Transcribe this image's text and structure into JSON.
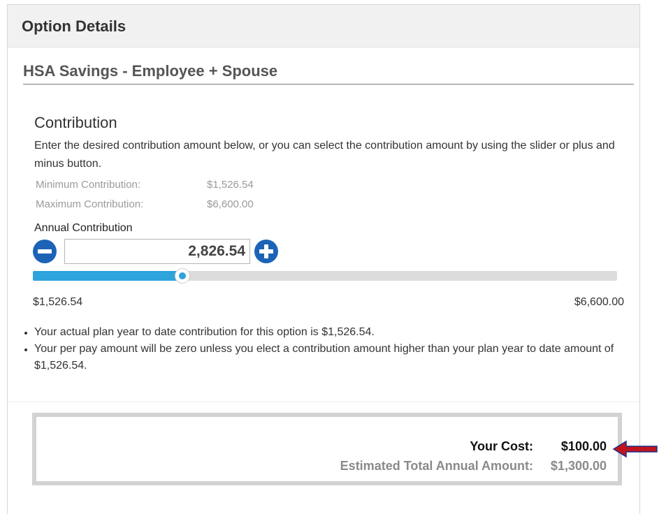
{
  "header": {
    "title": "Option Details"
  },
  "option": {
    "name": "HSA Savings - Employee + Spouse"
  },
  "contribution": {
    "title": "Contribution",
    "instructions": "Enter the desired contribution amount below, or you can select the contribution amount by using the slider or plus and minus button.",
    "minimum_label": "Minimum Contribution:",
    "minimum_value": "$1,526.54",
    "maximum_label": "Maximum Contribution:",
    "maximum_value": "$6,600.00",
    "annual_label": "Annual Contribution",
    "annual_value": "2,826.54",
    "minus_icon": "minus-circle-icon",
    "plus_icon": "plus-circle-icon"
  },
  "slider": {
    "min_label": "$1,526.54",
    "max_label": "$6,600.00",
    "min": 1526.54,
    "max": 6600.0,
    "value": 2826.54
  },
  "notes": [
    "Your actual plan year to date contribution for this option is $1,526.54.",
    "Your per pay amount will be zero unless you elect a contribution amount higher than your plan year to date amount of $1,526.54."
  ],
  "cost": {
    "your_cost_label": "Your Cost:",
    "your_cost_value": "$100.00",
    "annual_label": "Estimated Total Annual Amount:",
    "annual_value": "$1,300.00"
  },
  "colors": {
    "accent": "#2ea3dc",
    "button": "#1c63b8",
    "arrow": "#c0141c"
  }
}
